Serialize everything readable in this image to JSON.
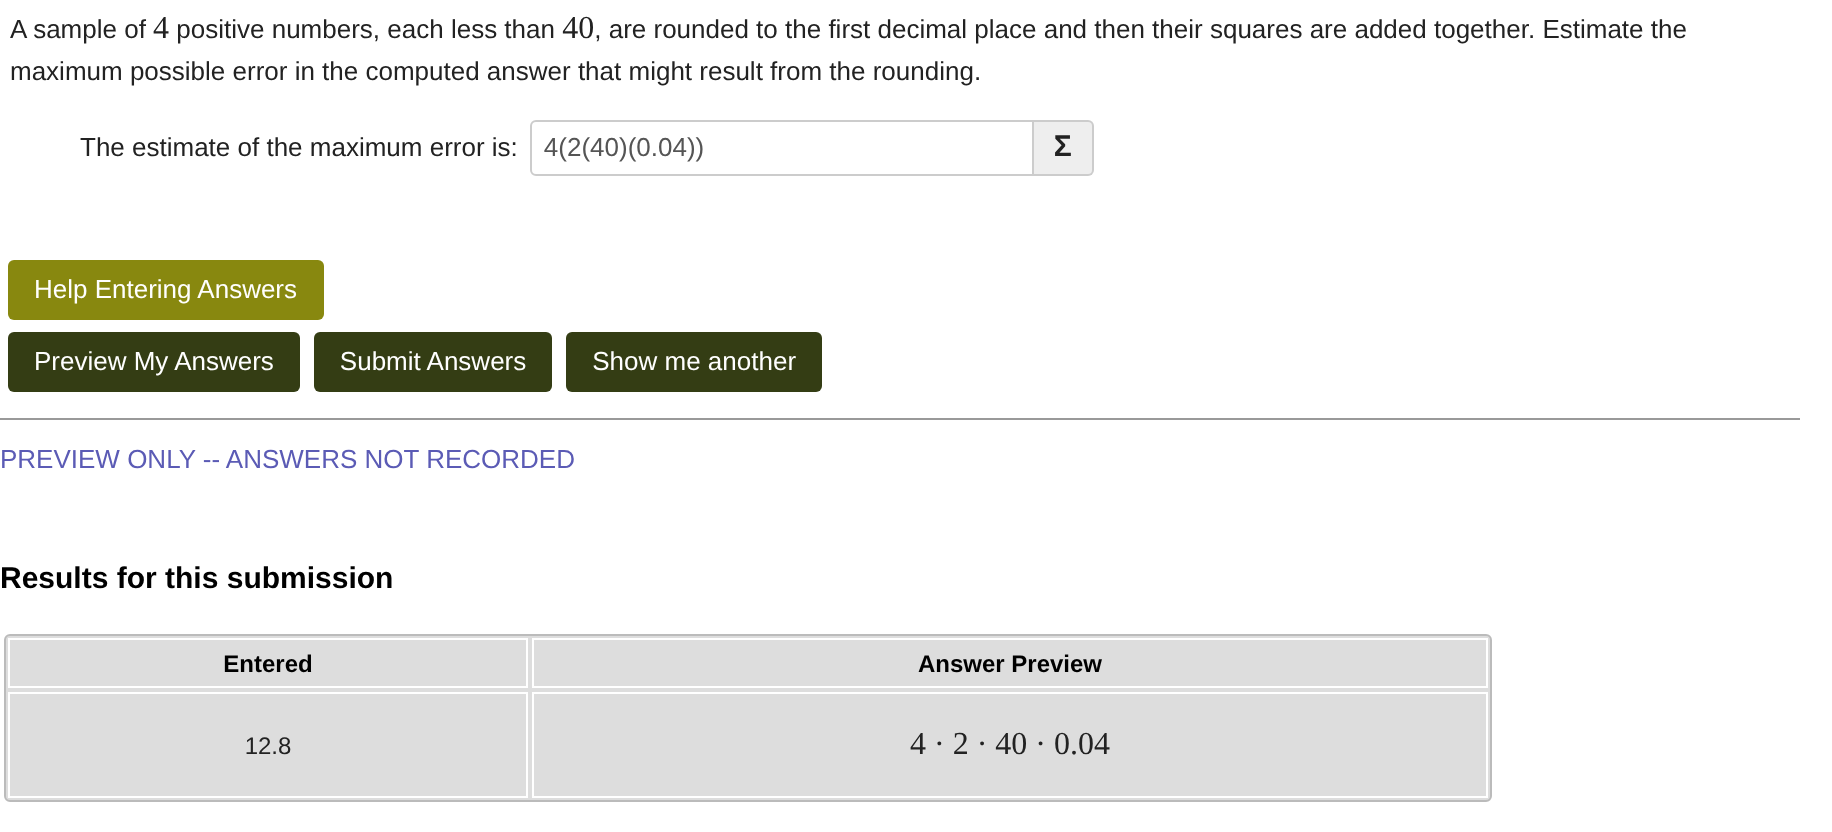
{
  "problem": {
    "segments": [
      {
        "kind": "text",
        "text": "A sample of "
      },
      {
        "kind": "math",
        "text": "4"
      },
      {
        "kind": "text",
        "text": " positive numbers, each less than "
      },
      {
        "kind": "math",
        "text": "40"
      },
      {
        "kind": "text",
        "text": ", are rounded to the first decimal place and then their squares are added together. Estimate the maximum possible error in the computed answer that might result from the rounding."
      }
    ]
  },
  "answer": {
    "label": "The estimate of the maximum error is:",
    "value": "4(2(40)(0.04))",
    "button": "Σ"
  },
  "help_button": "Help Entering Answers",
  "buttons": [
    "Preview My Answers",
    "Submit Answers",
    "Show me another"
  ],
  "notice": "PREVIEW ONLY -- ANSWERS NOT RECORDED",
  "results": {
    "title": "Results for this submission",
    "columns": [
      "Entered",
      "Answer Preview"
    ],
    "rows": [
      {
        "entered": "12.8",
        "preview": "4 · 2 · 40 · 0.04"
      }
    ]
  }
}
